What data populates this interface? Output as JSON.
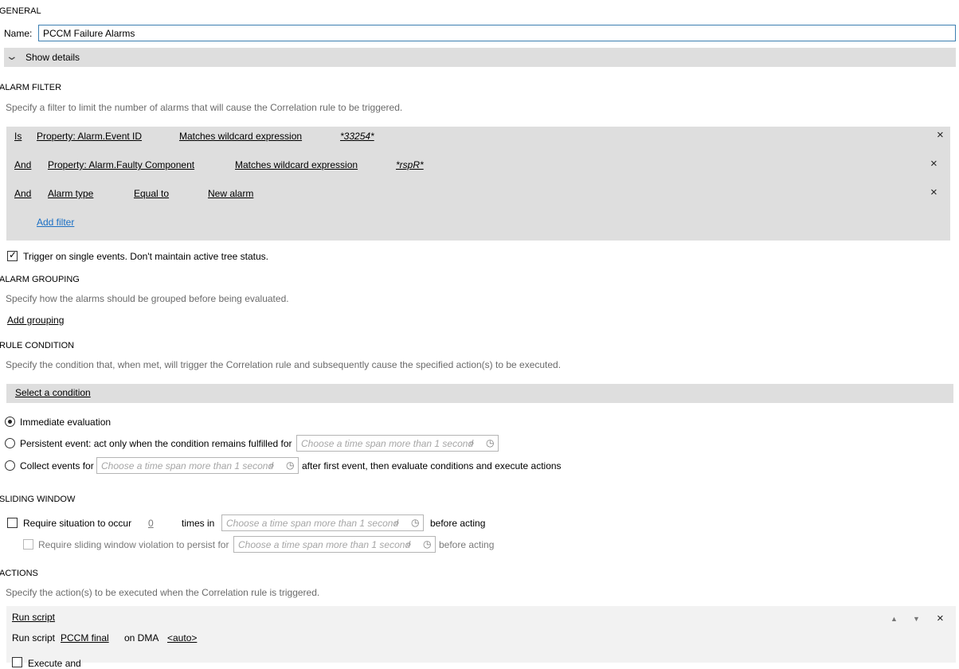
{
  "general": {
    "heading": "GENERAL",
    "name_label": "Name:",
    "name_value": "PCCM Failure Alarms",
    "show_details": "Show details"
  },
  "alarm_filter": {
    "heading": "ALARM FILTER",
    "description": "Specify a filter to limit the number of alarms that will cause the Correlation rule to be triggered.",
    "rows": [
      {
        "op": "Is",
        "property": "Property: Alarm.Event ID",
        "comparison": "Matches wildcard expression",
        "value": "*33254*"
      },
      {
        "op": "And",
        "property": "Property: Alarm.Faulty Component",
        "comparison": "Matches wildcard expression",
        "value": "*rspR*"
      },
      {
        "op": "And",
        "property": "Alarm type",
        "comparison": "Equal to",
        "value": "New alarm"
      }
    ],
    "add_filter": "Add filter",
    "trigger_single": "Trigger on single events. Don't maintain active tree status."
  },
  "alarm_grouping": {
    "heading": "ALARM GROUPING",
    "description": "Specify how the alarms should be grouped before being evaluated.",
    "add_grouping": "Add grouping"
  },
  "rule_condition": {
    "heading": "RULE CONDITION",
    "description": "Specify the condition that, when met, will trigger the Correlation rule and subsequently cause the specified action(s) to be executed.",
    "select_condition": "Select a condition",
    "immediate": "Immediate evaluation",
    "persistent": "Persistent event: act only when the condition remains fulfilled for",
    "collect": "Collect events for",
    "collect_after": "after first event, then evaluate conditions and execute actions",
    "timespan_placeholder": "Choose a time span more than 1 second"
  },
  "sliding_window": {
    "heading": "SLIDING WINDOW",
    "require_situation": "Require situation to occur",
    "count": "0",
    "times_in": "times in",
    "before_acting": "before acting",
    "require_violation": "Require sliding window violation to persist for"
  },
  "actions": {
    "heading": "ACTIONS",
    "description": "Specify the action(s) to be executed when the Correlation rule is triggered.",
    "title": "Run script",
    "run_script_label": "Run script",
    "script_name": "PCCM final",
    "on_dma": "on DMA",
    "dma_value": "<auto>",
    "partial_label": "Execute and"
  },
  "icons": {
    "close": "×",
    "chevron": "chevron-down-icon",
    "search": "search-icon",
    "clock": "clock-icon"
  }
}
